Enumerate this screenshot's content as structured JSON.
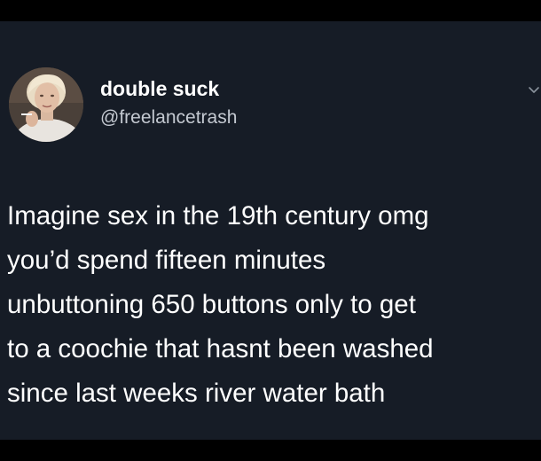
{
  "tweet": {
    "author": {
      "display_name": "double suck",
      "handle": "@freelancetrash",
      "avatar_icon": "profile-photo"
    },
    "menu_icon": "chevron-down-icon",
    "text_lines": [
      "Imagine sex in the 19th century omg",
      "you’d spend fifteen minutes",
      "unbuttoning 650 buttons only to get",
      "to a coochie that hasnt been washed",
      "since last weeks river water bath"
    ]
  },
  "colors": {
    "background": "#000000",
    "card": "#161c26",
    "text": "#ffffff",
    "handle": "#c4c9d1"
  }
}
